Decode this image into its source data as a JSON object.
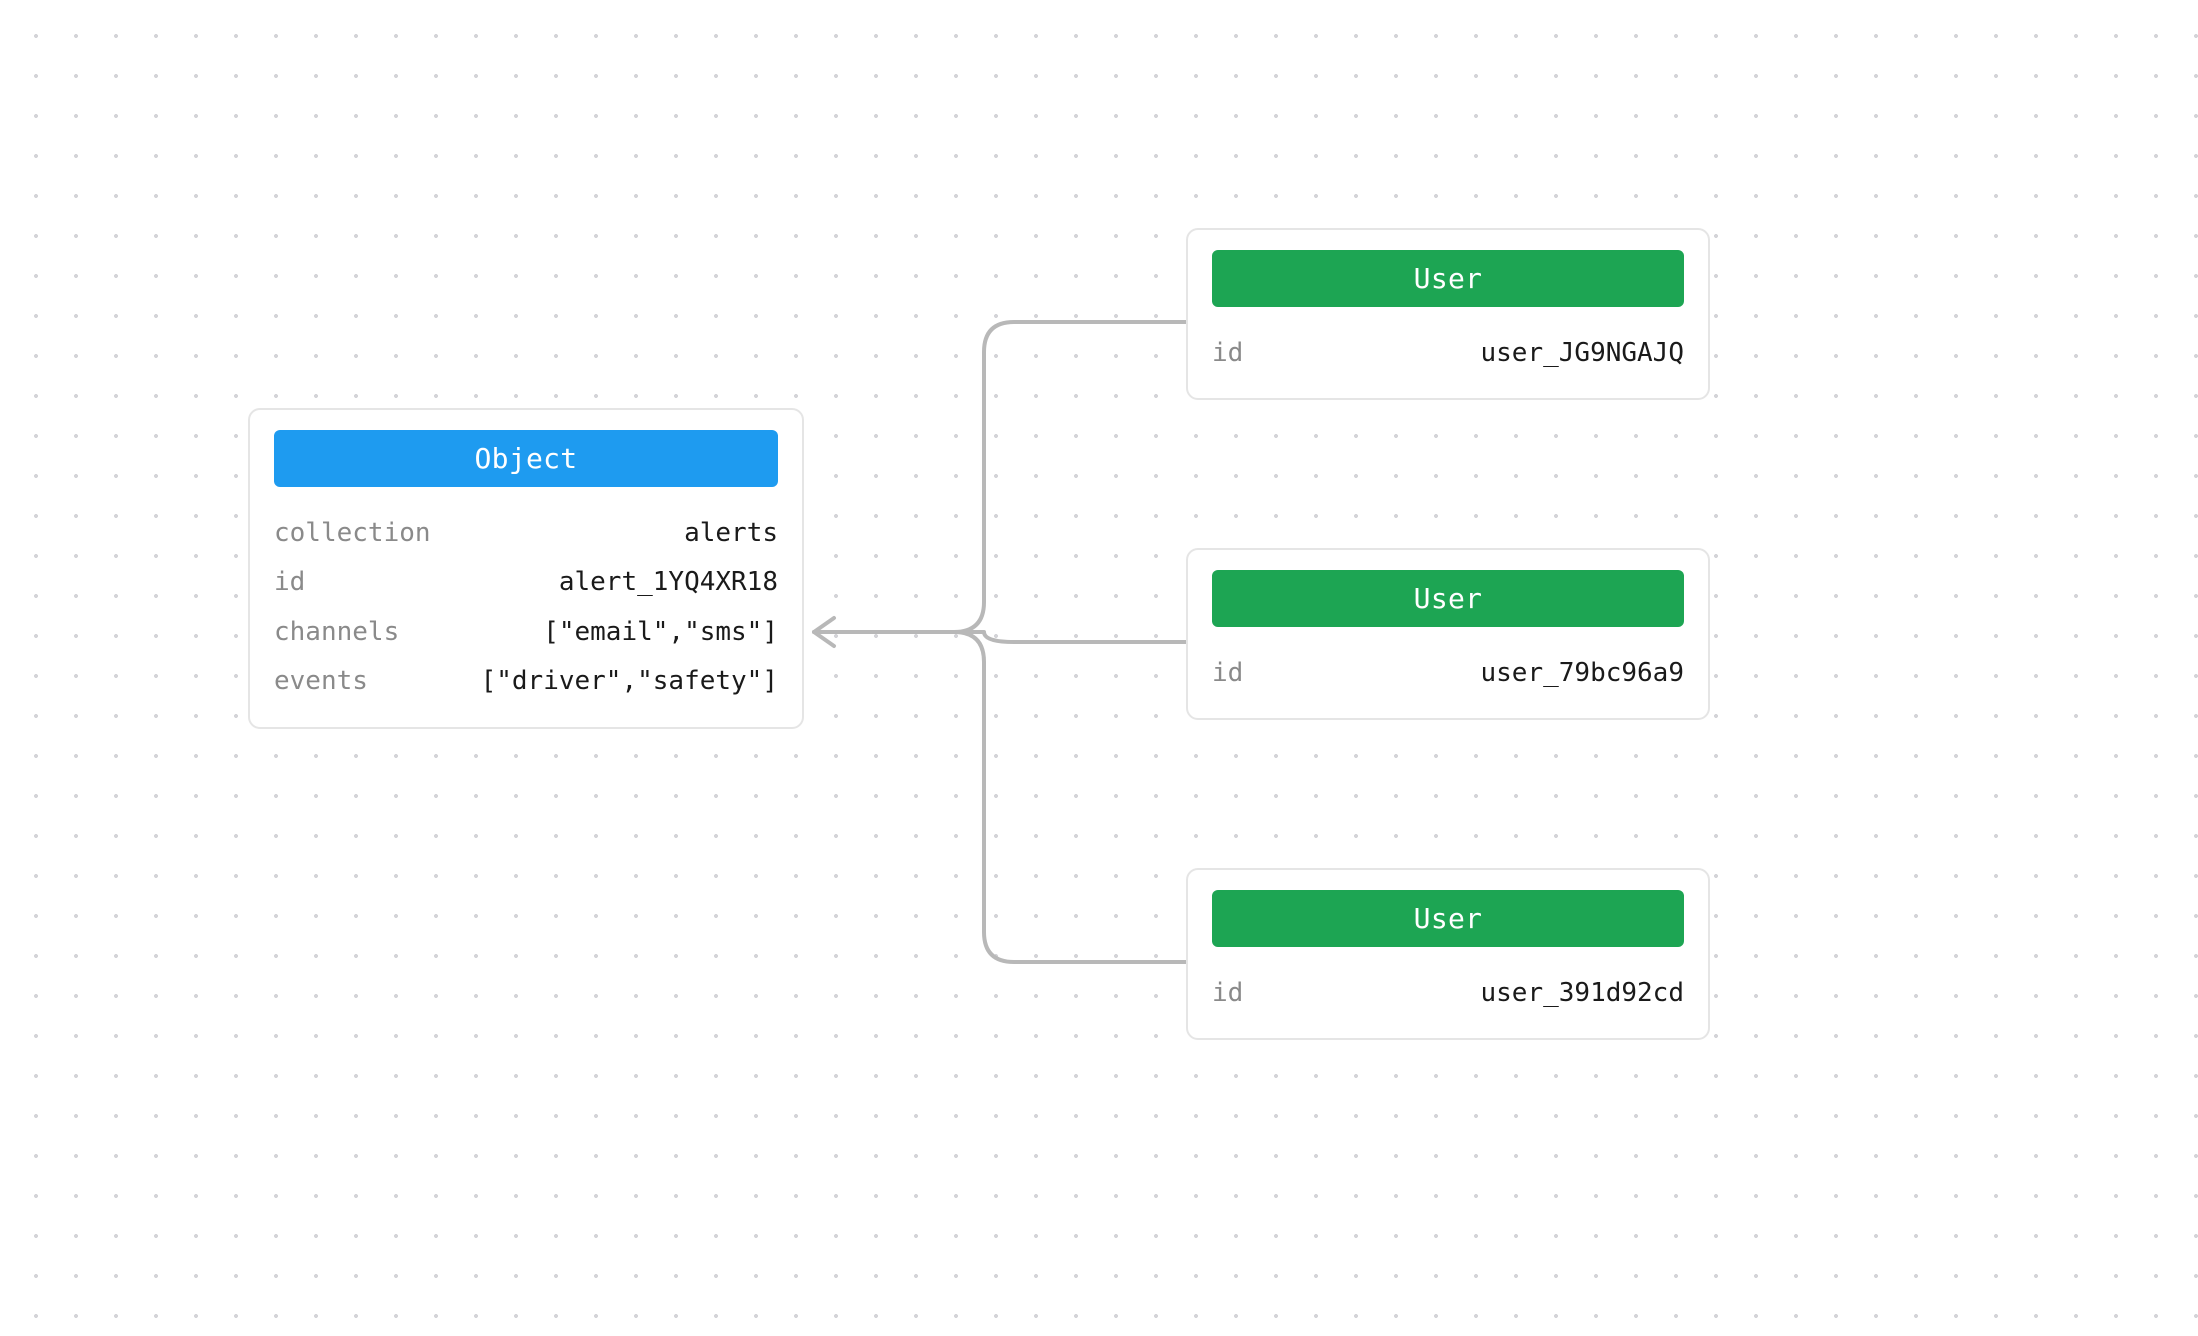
{
  "object": {
    "header": "Object",
    "fields": {
      "collection_label": "collection",
      "collection_value": "alerts",
      "id_label": "id",
      "id_value": "alert_1YQ4XR18",
      "channels_label": "channels",
      "channels_value": "[\"email\",\"sms\"]",
      "events_label": "events",
      "events_value": "[\"driver\",\"safety\"]"
    }
  },
  "users": [
    {
      "header": "User",
      "id_label": "id",
      "id_value": "user_JG9NGAJQ"
    },
    {
      "header": "User",
      "id_label": "id",
      "id_value": "user_79bc96a9"
    },
    {
      "header": "User",
      "id_label": "id",
      "id_value": "user_391d92cd"
    }
  ],
  "colors": {
    "object_header": "#1e9bf0",
    "user_header": "#1da553",
    "border": "#e5e5e5",
    "connector": "#b8b8b8"
  }
}
